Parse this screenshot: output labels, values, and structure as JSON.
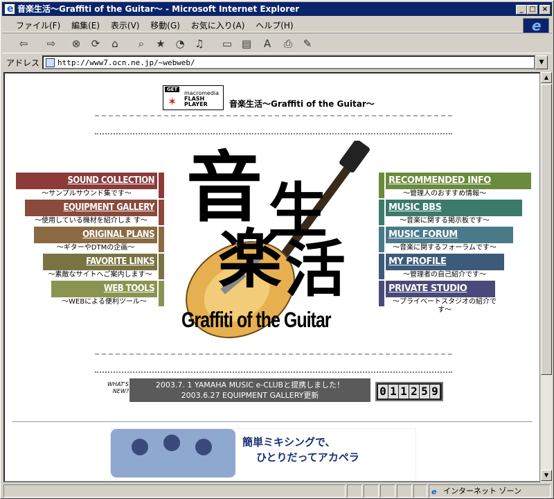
{
  "window": {
    "title": "音楽生活〜Graffiti of the Guitar〜 - Microsoft Internet Explorer",
    "min": "_",
    "max": "□",
    "close": "×"
  },
  "menu": [
    "ファイル(F)",
    "編集(E)",
    "表示(V)",
    "移動(G)",
    "お気に入り(A)",
    "ヘルプ(H)"
  ],
  "address": {
    "label": "アドレス",
    "url": "http://www7.ocn.ne.jp/~webweb/"
  },
  "page": {
    "flash_badge": {
      "get": "GET",
      "macromedia": "macromedia",
      "flash": "FLASH",
      "player": "PLAYER"
    },
    "title": "音楽生活〜Graffiti of the Guitar〜",
    "left_nav": [
      {
        "label": "SOUND COLLECTION",
        "sub": "〜サンプルサウンド集です〜",
        "color": "#8c3a3a"
      },
      {
        "label": "EQUIPMENT GALLERY",
        "sub": "〜使用している機材を紹介しま す〜",
        "color": "#8a4a3c"
      },
      {
        "label": "ORIGINAL PLANS",
        "sub": "〜ギターやDTMの企画〜",
        "color": "#8a6a42"
      },
      {
        "label": "FAVORITE LINKS",
        "sub": "〜素敵なサイトへご案内します〜",
        "color": "#7a7442"
      },
      {
        "label": "WEB TOOLS",
        "sub": "〜WEBによる便利ツール〜",
        "color": "#8a9450"
      }
    ],
    "right_nav": [
      {
        "label": "RECOMMENDED INFO",
        "sub": "〜管理人のおすすめ情報〜",
        "color": "#6a8a3c"
      },
      {
        "label": "MUSIC BBS",
        "sub": "〜音楽に関する掲示板です〜",
        "color": "#3c7a6a"
      },
      {
        "label": "MUSIC FORUM",
        "sub": "〜音楽に関するフォーラムです〜",
        "color": "#4a7a8a"
      },
      {
        "label": "MY PROFILE",
        "sub": "〜管理者の自己紹介です〜",
        "color": "#3c5a7a"
      },
      {
        "label": "PRIVATE STUDIO",
        "sub": "〜プライベートスタジオの紹介で す〜",
        "color": "#4a4a7a"
      }
    ],
    "logo": {
      "k1": "音",
      "k2": "生",
      "k3": "楽",
      "k4": "活",
      "tagline": "Graffiti of the Guitar"
    },
    "whats_new_label": "WHAT'S NEW?",
    "news": [
      "2003.7. 1 YAMAHA MUSIC e-CLUBと提携しました！",
      "2003.6.27 EQUIPMENT GALLERY更新"
    ],
    "counter": [
      "0",
      "1",
      "1",
      "2",
      "5",
      "9"
    ],
    "banner": {
      "line1": "簡単ミキシングで、",
      "line2": "ひとりだってアカペラ"
    }
  },
  "status": {
    "zone": "インターネット ゾーン"
  }
}
